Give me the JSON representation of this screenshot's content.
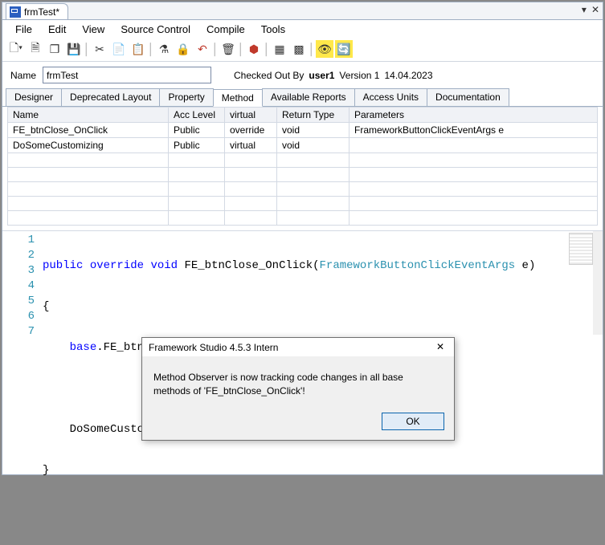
{
  "docTab": {
    "title": "frmTest*"
  },
  "menu": [
    "File",
    "Edit",
    "View",
    "Source Control",
    "Compile",
    "Tools"
  ],
  "nameRow": {
    "label": "Name",
    "value": "frmTest",
    "checkedOutBy_label": "Checked Out By",
    "checkedOutBy_value": "user1",
    "version_label": "Version 1",
    "date": "14.04.2023"
  },
  "tabs": [
    "Designer",
    "Deprecated Layout",
    "Property",
    "Method",
    "Available Reports",
    "Access Units",
    "Documentation"
  ],
  "activeTab": "Method",
  "grid": {
    "headers": [
      "Name",
      "Acc Level",
      "virtual",
      "Return Type",
      "Parameters"
    ],
    "rows": [
      {
        "name": "FE_btnClose_OnClick",
        "acc": "Public",
        "virt": "override",
        "ret": "void",
        "params": "FrameworkButtonClickEventArgs e"
      },
      {
        "name": "DoSomeCustomizing",
        "acc": "Public",
        "virt": "virtual",
        "ret": "void",
        "params": ""
      }
    ]
  },
  "code": {
    "lines": [
      1,
      2,
      3,
      4,
      5,
      6,
      7
    ],
    "l1_kw1": "public",
    "l1_kw2": "override",
    "l1_kw3": "void",
    "l1_name": "FE_btnClose_OnClick",
    "l1_paren_open": "(",
    "l1_type": "FrameworkButtonClickEventArgs",
    "l1_arg": " e",
    "l1_paren_close": ")",
    "l2": "{",
    "l3_pre": "    ",
    "l3_kw": "base",
    "l3_rest": ".FE_btnClose_OnClick(e);",
    "l4": "",
    "l5_pre": "    ",
    "l5_rest": "DoSomeCustomizing();",
    "l6": "}",
    "l7": ""
  },
  "dialog": {
    "title": "Framework Studio 4.5.3 Intern",
    "body": "Method Observer is now tracking code changes in all base methods of 'FE_btnClose_OnClick'!",
    "ok": "OK"
  }
}
